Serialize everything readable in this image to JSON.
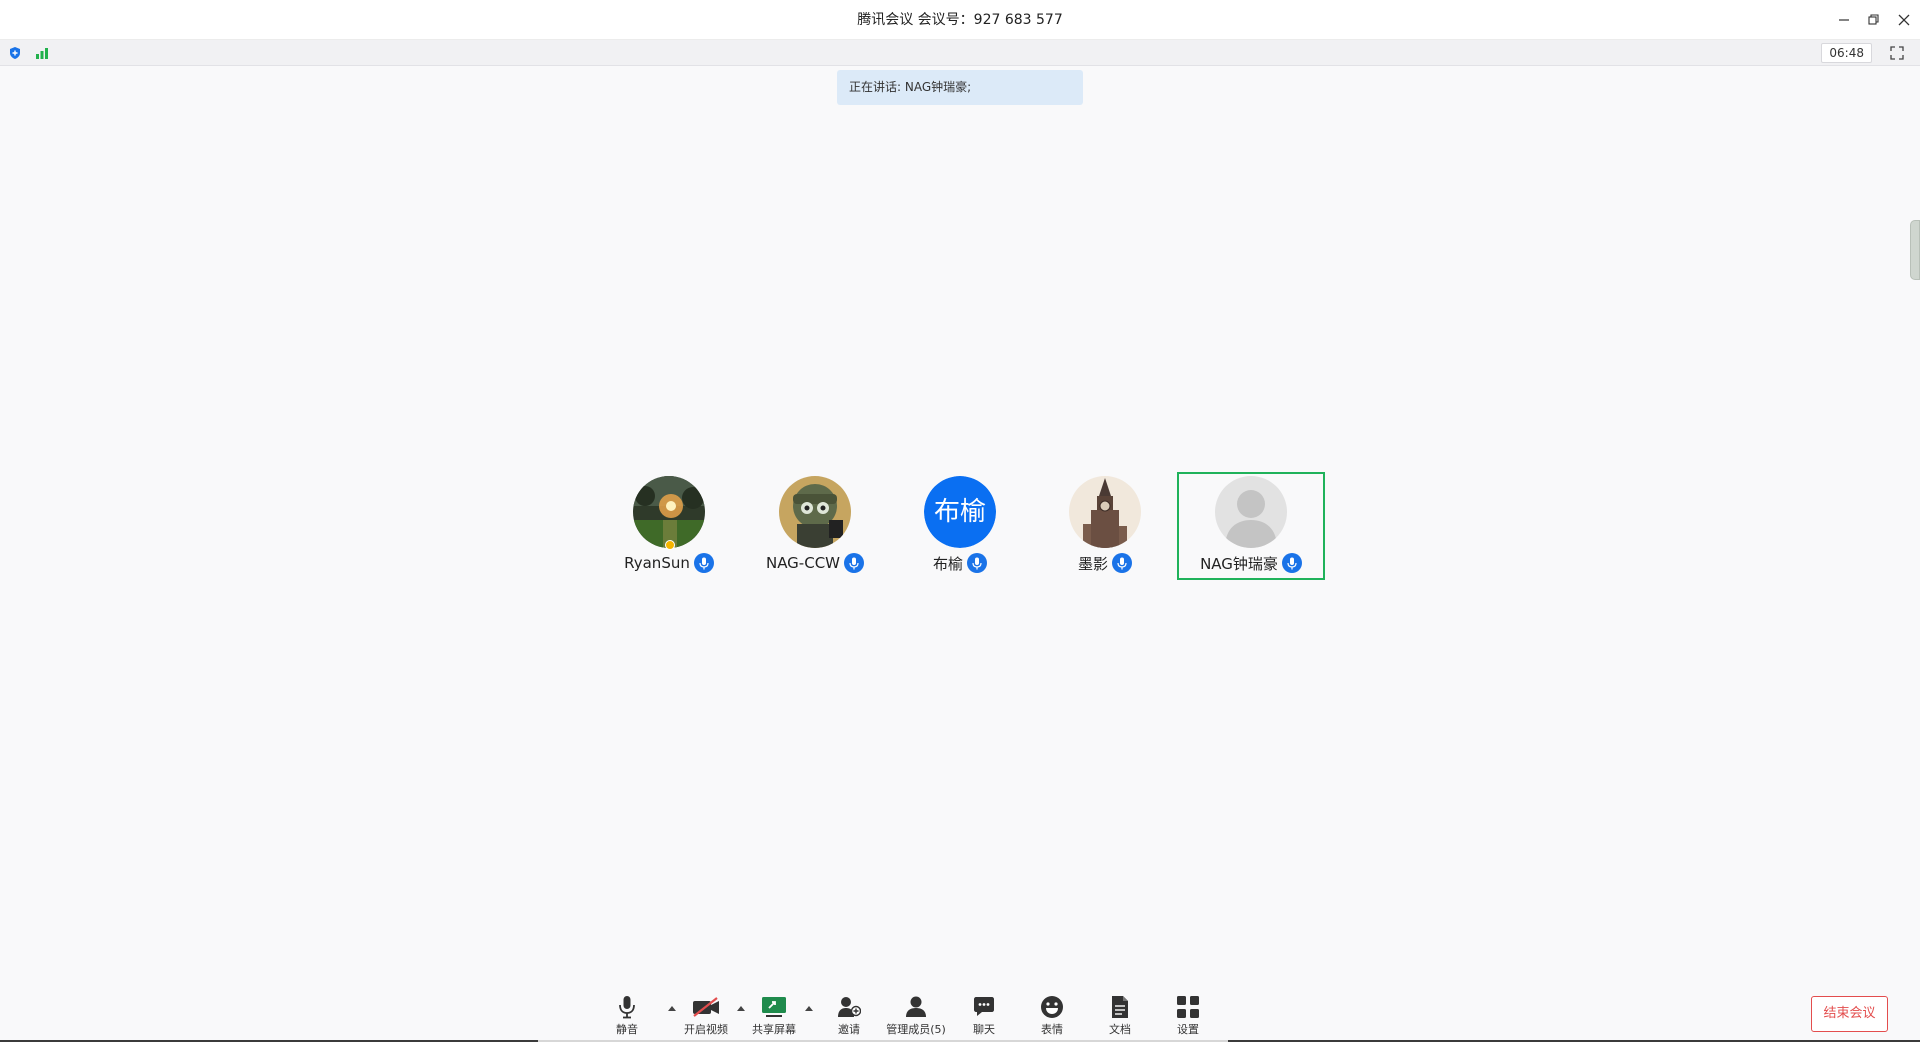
{
  "window": {
    "title": "腾讯会议 会议号：927 683 577"
  },
  "status": {
    "timer": "06:48"
  },
  "speaking": {
    "text": "正在讲话: NAG钟瑞豪;"
  },
  "participants": [
    {
      "name": "RyanSun",
      "avatar": "photo-garden-night"
    },
    {
      "name": "NAG-CCW",
      "avatar": "photo-cartoon-soldier"
    },
    {
      "name": "布榆",
      "avatar_text": "布榆"
    },
    {
      "name": "墨影",
      "avatar": "photo-clock-tower"
    },
    {
      "name": "NAG钟瑞豪",
      "avatar": "default-person",
      "active": true
    }
  ],
  "toolbar": {
    "mute_label": "静音",
    "video_label": "开启视频",
    "share_label": "共享屏幕",
    "invite_label": "邀请",
    "members_label": "管理成员(5)",
    "chat_label": "聊天",
    "emoji_label": "表情",
    "docs_label": "文档",
    "settings_label": "设置",
    "end_label": "结束会议"
  },
  "colors": {
    "accent": "#1a73e8",
    "active_border": "#1fb25a",
    "end_red": "#e34d4d",
    "speaking_bg": "#dceaf8"
  }
}
